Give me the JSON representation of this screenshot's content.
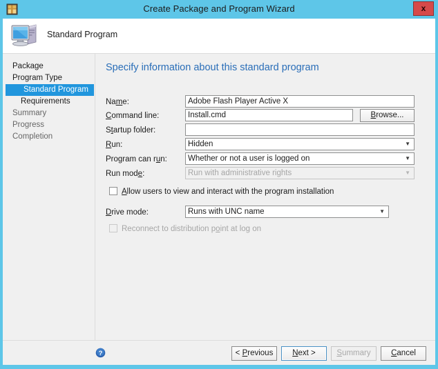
{
  "window": {
    "title": "Create Package and Program Wizard",
    "titlebar_icon": "package-icon",
    "close_label": "x",
    "accent_titlebar": "#5ec6e8",
    "accent_close": "#d64a4a"
  },
  "header": {
    "icon": "computer-icon",
    "title": "Standard Program"
  },
  "sidebar": {
    "items": [
      {
        "label": "Package",
        "style": "top",
        "selected": false
      },
      {
        "label": "Program Type",
        "style": "top",
        "selected": false
      },
      {
        "label": "Standard Program",
        "style": "sub",
        "selected": true
      },
      {
        "label": "Requirements",
        "style": "sub",
        "selected": false
      },
      {
        "label": "Summary",
        "style": "plain",
        "selected": false
      },
      {
        "label": "Progress",
        "style": "plain",
        "selected": false
      },
      {
        "label": "Completion",
        "style": "plain",
        "selected": false
      }
    ],
    "selected_color": "#2196dd"
  },
  "main": {
    "heading": "Specify information about this standard program",
    "heading_color": "#2a6eb8",
    "fields": {
      "name": {
        "label_pre": "Na",
        "label_accel": "m",
        "label_post": "e:",
        "value": "Adobe Flash Player Active X",
        "placeholder": ""
      },
      "command_line": {
        "label_pre": "",
        "label_accel": "C",
        "label_post": "ommand line:",
        "value": "Install.cmd",
        "placeholder": "",
        "browse_pre": "",
        "browse_accel": "B",
        "browse_post": "rowse..."
      },
      "startup_folder": {
        "label_pre": "S",
        "label_accel": "t",
        "label_post": "artup folder:",
        "value": "",
        "placeholder": ""
      },
      "run": {
        "label_pre": "",
        "label_accel": "R",
        "label_post": "un:",
        "value": "Hidden",
        "arrow": "chevron-down-icon",
        "disabled": false
      },
      "program_can_run": {
        "label_pre": "Program can r",
        "label_accel": "u",
        "label_post": "n:",
        "value": "Whether or not a user is logged on",
        "arrow": "chevron-down-icon",
        "disabled": false
      },
      "run_mode": {
        "label_pre": "Run mod",
        "label_accel": "e",
        "label_post": ":",
        "value": "Run with administrative rights",
        "arrow": "chevron-down-icon",
        "disabled": true
      },
      "allow_users": {
        "label_pre": "",
        "label_accel": "A",
        "label_post": "llow users to view and interact with the program installation",
        "checked": false,
        "disabled": false
      },
      "drive_mode": {
        "label_pre": "",
        "label_accel": "D",
        "label_post": "rive mode:",
        "value": "Runs with UNC name",
        "arrow": "chevron-down-icon",
        "disabled": false
      },
      "reconnect": {
        "label_pre": "Reconnect to distribution p",
        "label_accel": "o",
        "label_post": "int at log on",
        "checked": false,
        "disabled": true
      }
    }
  },
  "footer": {
    "help_icon": "help-icon",
    "buttons": [
      {
        "pre": "< ",
        "accel": "P",
        "post": "revious",
        "disabled": false,
        "focused": false
      },
      {
        "pre": "",
        "accel": "N",
        "post": "ext >",
        "disabled": false,
        "focused": true
      },
      {
        "pre": "",
        "accel": "S",
        "post": "ummary",
        "disabled": true,
        "focused": false
      },
      {
        "pre": "",
        "accel": "C",
        "post": "ancel",
        "disabled": false,
        "focused": false
      }
    ]
  }
}
